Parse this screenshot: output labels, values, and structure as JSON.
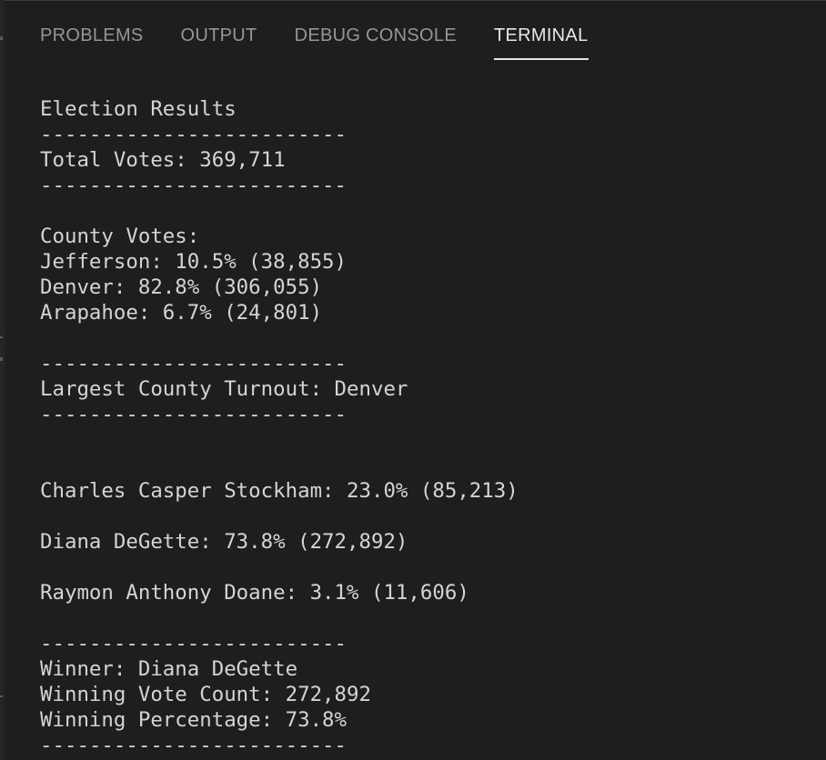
{
  "tabs": [
    {
      "label": "PROBLEMS",
      "active": false
    },
    {
      "label": "OUTPUT",
      "active": false
    },
    {
      "label": "DEBUG CONSOLE",
      "active": false
    },
    {
      "label": "TERMINAL",
      "active": true
    }
  ],
  "terminal": {
    "lines": [
      "Election Results",
      "-------------------------",
      "Total Votes: 369,711",
      "-------------------------",
      "",
      "County Votes:",
      "Jefferson: 10.5% (38,855)",
      "Denver: 82.8% (306,055)",
      "Arapahoe: 6.7% (24,801)",
      "",
      "-------------------------",
      "Largest County Turnout: Denver",
      "-------------------------",
      "",
      "",
      "Charles Casper Stockham: 23.0% (85,213)",
      "",
      "Diana DeGette: 73.8% (272,892)",
      "",
      "Raymon Anthony Doane: 3.1% (11,606)",
      "",
      "-------------------------",
      "Winner: Diana DeGette",
      "Winning Vote Count: 272,892",
      "Winning Percentage: 73.8%",
      "-------------------------"
    ]
  }
}
